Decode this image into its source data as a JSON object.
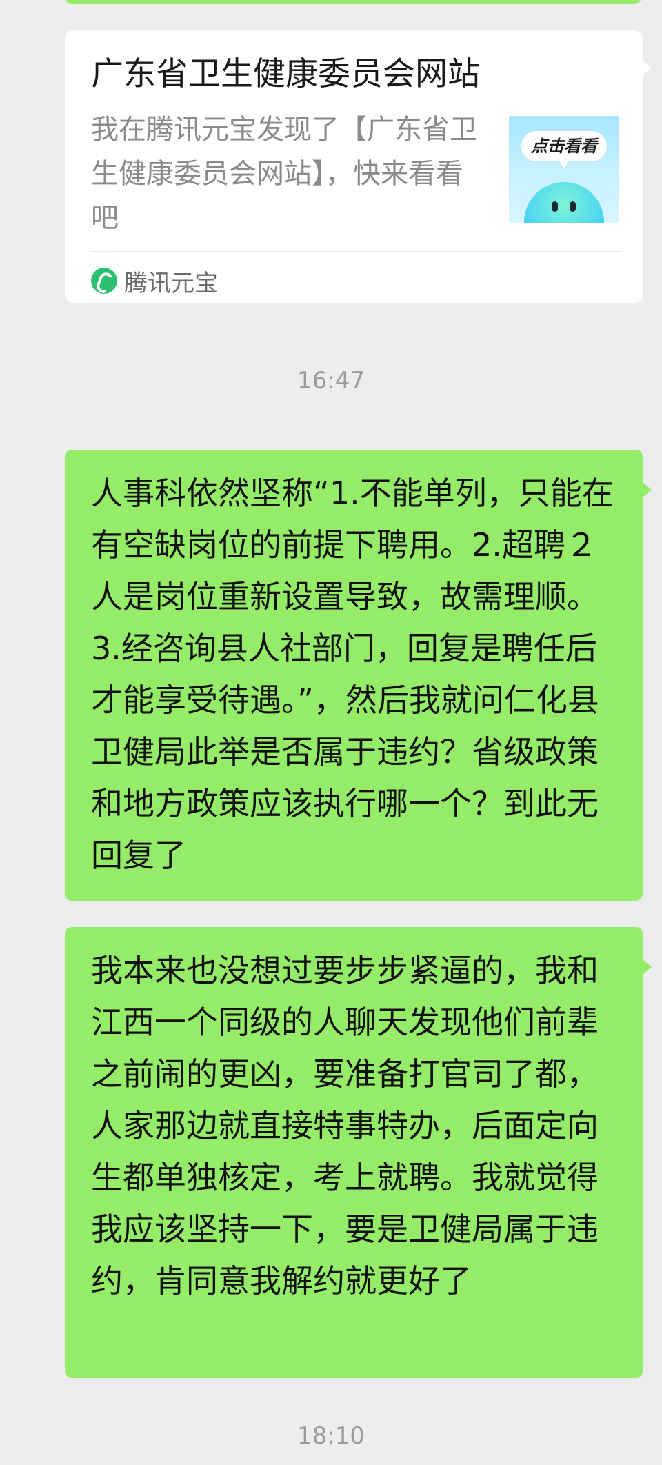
{
  "link_card": {
    "title": "广东省卫生健康委员会网站",
    "description": "我在腾讯元宝发现了【广东省卫生健康委员会网站】，快来看看吧",
    "thumbnail_label": "点击看看",
    "source_name": "腾讯元宝",
    "source_icon": "yuanbao-logo-icon"
  },
  "messages": [
    {
      "time": "16:47",
      "text": "人事科依然坚称“1.不能单列，只能在有空缺岗位的前提下聘用。2.超聘２人是岗位重新设置导致，故需理顺。3.经咨询县人社部门，回复是聘任后才能享受待遇。”，然后我就问仁化县卫健局此举是否属于违约？省级政策和地方政策应该执行哪一个？到此无回复了"
    },
    {
      "text": "我本来也没想过要步步紧逼的，我和江西一个同级的人聊天发现他们前辈之前闹的更凶，要准备打官司了都，人家那边就直接特事特办，后面定向生都单独核定，考上就聘。我就觉得我应该坚持一下，要是卫健局属于违约，肯同意我解约就更好了"
    }
  ],
  "bottom_time": "18:10",
  "colors": {
    "background": "#ededed",
    "sent_bubble": "#95ec69",
    "card": "#ffffff"
  }
}
